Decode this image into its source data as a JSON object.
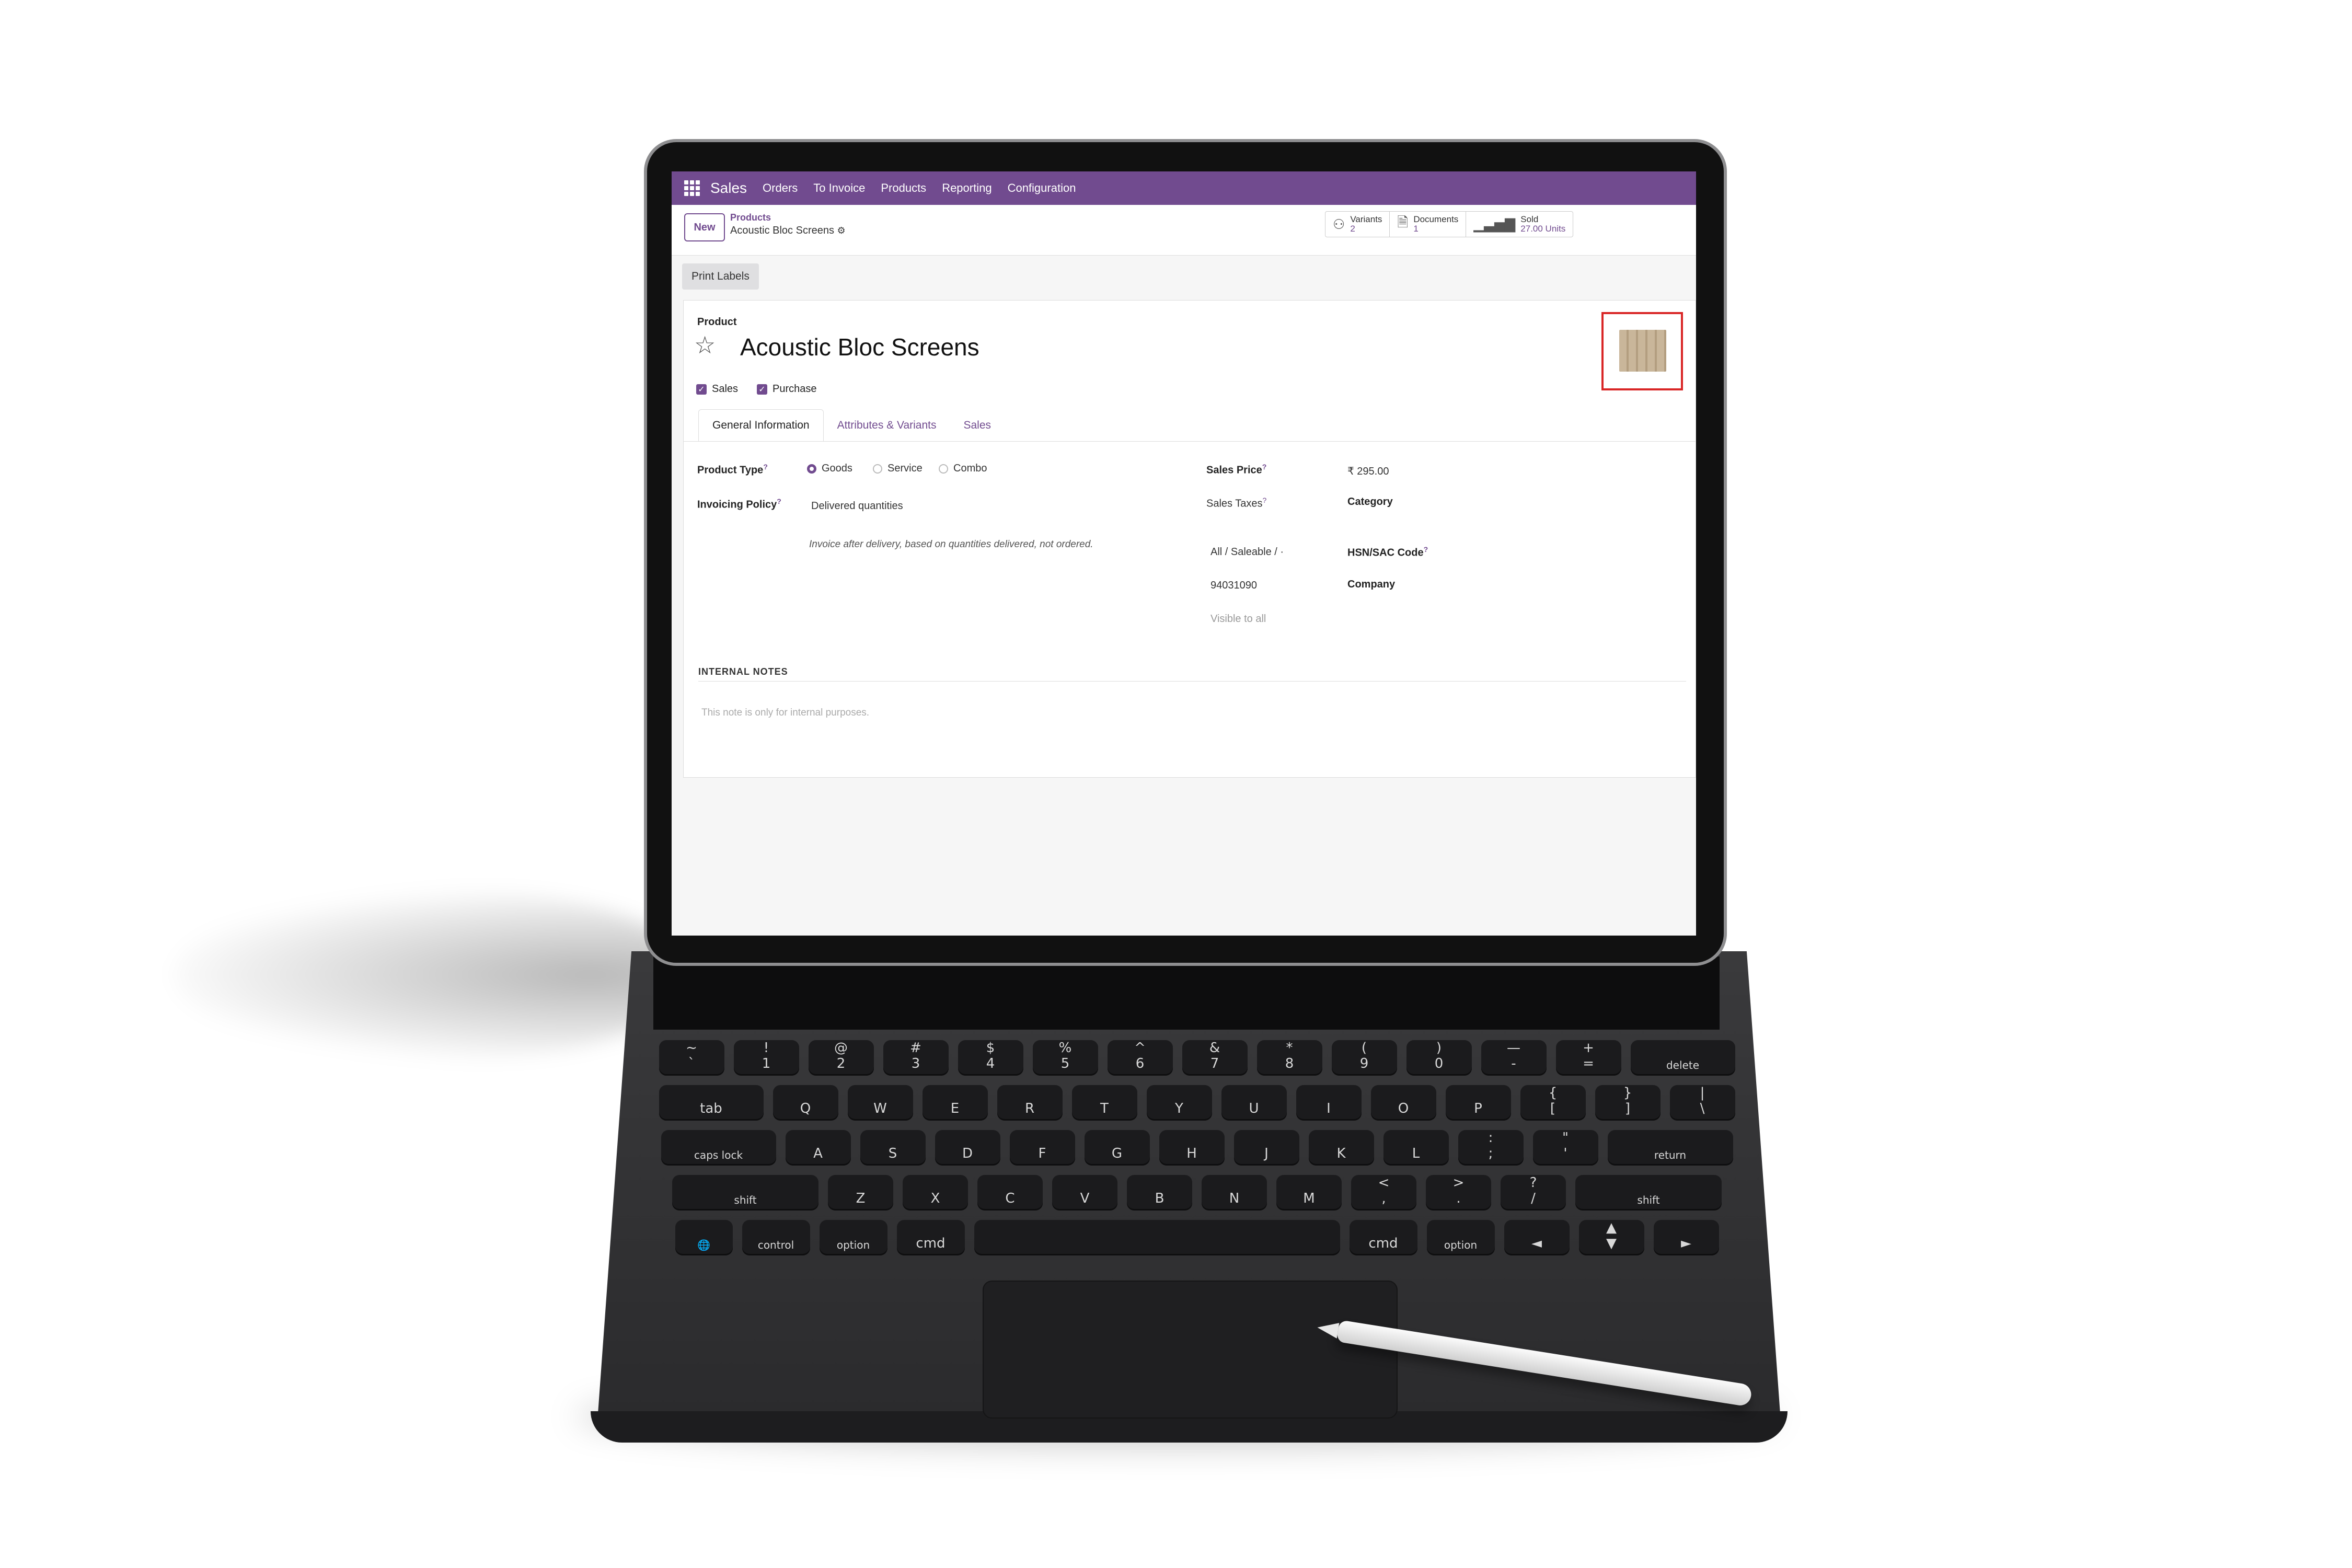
{
  "navbar": {
    "app_name": "Sales",
    "menus": [
      "Orders",
      "To Invoice",
      "Products",
      "Reporting",
      "Configuration"
    ]
  },
  "control_panel": {
    "new_label": "New",
    "breadcrumb_parent": "Products",
    "breadcrumb_current": "Acoustic Bloc Screens",
    "stats": [
      {
        "icon": "variants-icon",
        "label": "Variants",
        "value": "2"
      },
      {
        "icon": "document-icon",
        "label": "Documents",
        "value": "1"
      },
      {
        "icon": "chart-icon",
        "label": "Sold",
        "value": "27.00 Units"
      }
    ]
  },
  "actions": {
    "print_labels": "Print Labels"
  },
  "form": {
    "product_label": "Product",
    "product_name": "Acoustic Bloc Screens",
    "sales_check": "Sales",
    "purchase_check": "Purchase",
    "tabs": [
      "General Information",
      "Attributes & Variants",
      "Sales"
    ],
    "product_type_label": "Product Type",
    "product_type_options": [
      "Goods",
      "Service",
      "Combo"
    ],
    "product_type_selected": "Goods",
    "invoicing_policy_label": "Invoicing Policy",
    "invoicing_policy_value": "Delivered quantities",
    "invoicing_help": "Invoice after delivery, based on quantities delivered, not ordered.",
    "sales_price_label": "Sales Price",
    "sales_price_value": "₹ 295.00",
    "sales_taxes_label": "Sales Taxes",
    "category_label": "Category",
    "category_value": "All / Saleable / ·",
    "hsn_label": "HSN/SAC Code",
    "hsn_value": "94031090",
    "company_label": "Company",
    "company_value": "Visible to all",
    "internal_notes_label": "INTERNAL NOTES",
    "internal_notes_placeholder": "This note is only for internal purposes."
  },
  "keyboard": {
    "row1": [
      "~\n`",
      "!\n1",
      "@\n2",
      "#\n3",
      "$\n4",
      "%\n5",
      "^\n6",
      "&\n7",
      "*\n8",
      "(\n9",
      ")\n0",
      "—\n-",
      "+\n=",
      "delete"
    ],
    "row2": [
      "tab",
      "Q",
      "W",
      "E",
      "R",
      "T",
      "Y",
      "U",
      "I",
      "O",
      "P",
      "{\n[",
      "}\n]",
      "|\n\\"
    ],
    "row3": [
      "caps lock",
      "A",
      "S",
      "D",
      "F",
      "G",
      "H",
      "J",
      "K",
      "L",
      ":\n;",
      "\"\n'",
      "return"
    ],
    "row4": [
      "shift",
      "Z",
      "X",
      "C",
      "V",
      "B",
      "N",
      "M",
      "<\n,",
      ">\n.",
      "?\n/",
      "shift"
    ],
    "row5": [
      "globe",
      "control",
      "option",
      "cmd",
      "",
      "cmd",
      "option",
      "◄",
      "▲\n▼",
      "►"
    ]
  },
  "colors": {
    "brand": "#714b8f",
    "highlight": "#d92626"
  }
}
